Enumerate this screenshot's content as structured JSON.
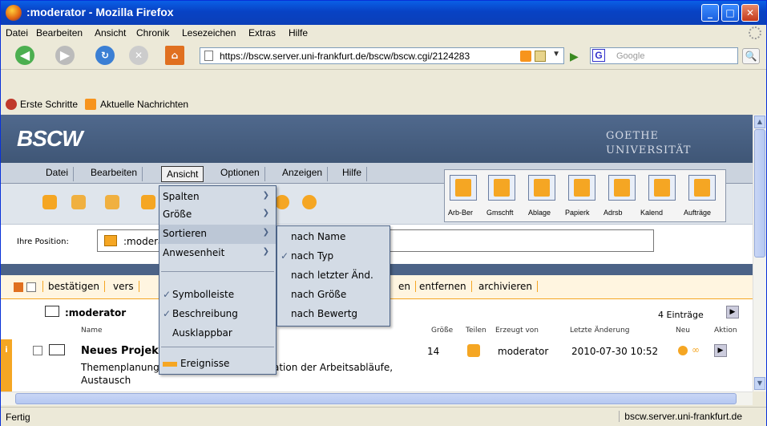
{
  "window": {
    "title": ":moderator - Mozilla Firefox"
  },
  "menubar": {
    "items": [
      "Datei",
      "Bearbeiten",
      "Ansicht",
      "Chronik",
      "Lesezeichen",
      "Extras",
      "Hilfe"
    ]
  },
  "nav": {
    "url": "https://bscw.server.uni-frankfurt.de/bscw/bscw.cgi/2124283",
    "search_placeholder": "Google"
  },
  "bookmarks": {
    "items": [
      "Erste Schritte",
      "Aktuelle Nachrichten"
    ]
  },
  "bscw": {
    "logo": "BSCW",
    "goethe_line1": "GOETHE",
    "goethe_line2": "UNIVERSITÄT",
    "menu": [
      "Datei",
      "Bearbeiten",
      "Ansicht",
      "Optionen",
      "Anzeigen",
      "Hilfe"
    ],
    "right_tools": [
      "Arb-Ber",
      "Gmschft",
      "Ablage",
      "Papierk",
      "Adrsb",
      "Kalend",
      "Aufträge"
    ],
    "position_label": "Ihre Position:",
    "position_value": ":moderator",
    "actions": [
      "bestätigen",
      "vers",
      "en",
      "entfernen",
      "archivieren"
    ],
    "folder_name": ":moderator",
    "entry_count": "4 Einträge",
    "columns": {
      "name": "Name",
      "size": "Größe",
      "share": "Teilen",
      "created_by": "Erzeugt von",
      "modified": "Letzte Änderung",
      "new": "Neu",
      "action": "Aktion"
    },
    "row": {
      "title": "Neues Projekt",
      "size": "14",
      "creator": "moderator",
      "date": "2010-07-30 10:52",
      "desc_left": "Themenplanung",
      "desc_right": "ation der Arbeitsabläufe,",
      "desc2": "Austausch"
    }
  },
  "ansicht_menu": {
    "items": [
      {
        "label": "Spalten",
        "submenu": true
      },
      {
        "label": "Größe",
        "submenu": true
      },
      {
        "label": "Sortieren",
        "submenu": true
      },
      {
        "label": "Anwesenheit",
        "submenu": true
      }
    ],
    "checks": [
      "Symbolleiste",
      "Beschreibung"
    ],
    "plain": "Ausklappbar",
    "events": "Ereignisse"
  },
  "sort_menu": {
    "items": [
      "nach Name",
      "nach Typ",
      "nach letzter Änd.",
      "nach Größe",
      "nach Bewertg"
    ],
    "checked": "nach Typ"
  },
  "status": {
    "left": "Fertig",
    "right": "bscw.server.uni-frankfurt.de"
  }
}
